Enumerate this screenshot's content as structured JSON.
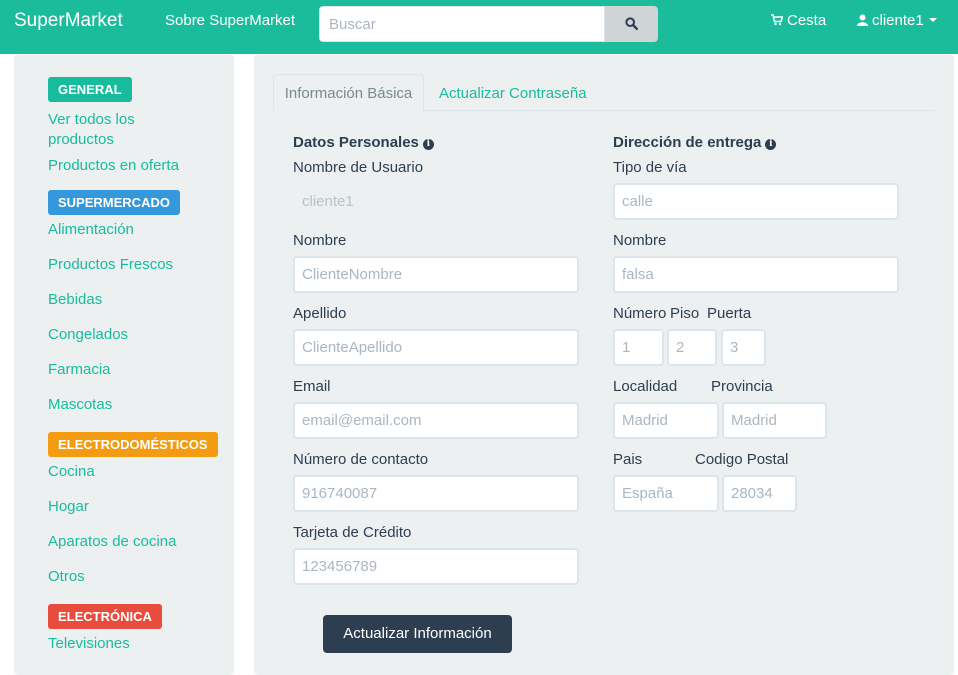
{
  "navbar": {
    "brand": "SuperMarket",
    "about": "Sobre SuperMarket",
    "search_placeholder": "Buscar",
    "cart": "Cesta",
    "user": "cliente1"
  },
  "sidebar": {
    "sections": [
      {
        "badge": "GENERAL",
        "color": "#18bc9c"
      },
      {
        "badge": "SUPERMERCADO",
        "color": "#3498db"
      },
      {
        "badge": "ELECTRODOMÉSTICOS",
        "color": "#f39c12"
      },
      {
        "badge": "ELECTRÓNICA",
        "color": "#e74c3c"
      }
    ],
    "links": {
      "ver_todos_1": "Ver todos los",
      "ver_todos_2": "productos",
      "oferta": "Productos en oferta",
      "alimentacion": "Alimentación",
      "frescos": "Productos Frescos",
      "bebidas": "Bebidas",
      "congelados": "Congelados",
      "farmacia": "Farmacia",
      "mascotas": "Mascotas",
      "cocina": "Cocina",
      "hogar": "Hogar",
      "aparatos": "Aparatos de cocina",
      "otros": "Otros",
      "televisiones": "Televisiones"
    }
  },
  "tabs": {
    "basic": "Información Básica",
    "password": "Actualizar Contraseña"
  },
  "personal": {
    "title": "Datos Personales",
    "username_label": "Nombre de Usuario",
    "username_value": "cliente1",
    "name_label": "Nombre",
    "name_value": "ClienteNombre",
    "surname_label": "Apellido",
    "surname_value": "ClienteApellido",
    "email_label": "Email",
    "email_value": "email@email.com",
    "phone_label": "Número de contacto",
    "phone_value": "916740087",
    "card_label": "Tarjeta de Crédito",
    "card_value": "123456789"
  },
  "address": {
    "title": "Dirección de entrega",
    "street_type_label": "Tipo de vía",
    "street_type_value": "calle",
    "name_label": "Nombre",
    "name_value": "falsa",
    "number_label": "Número",
    "floor_label": "Piso",
    "door_label": "Puerta",
    "number_value": "1",
    "floor_value": "2",
    "door_value": "3",
    "city_label": "Localidad",
    "province_label": "Provincia",
    "city_value": "Madrid",
    "province_value": "Madrid",
    "country_label": "Pais",
    "postal_label": "Codigo Postal",
    "country_value": "España",
    "postal_value": "28034"
  },
  "submit": "Actualizar Información"
}
